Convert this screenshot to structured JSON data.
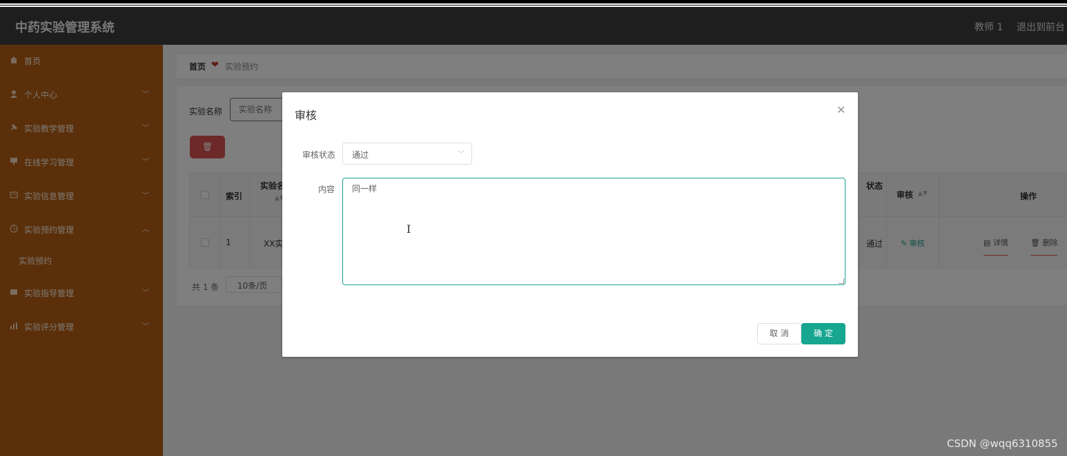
{
  "header": {
    "title": "中药实验管理系统",
    "user": "教师 1",
    "logout": "退出到前台"
  },
  "sidebar": {
    "items": [
      {
        "label": "首页",
        "icon": "home-icon"
      },
      {
        "label": "个人中心",
        "icon": "user-icon",
        "chevron": "﹀"
      },
      {
        "label": "实验教学管理",
        "icon": "pin-icon",
        "chevron": "﹀"
      },
      {
        "label": "在线学习管理",
        "icon": "monitor-icon",
        "chevron": "﹀"
      },
      {
        "label": "实验信息管理",
        "icon": "card-icon",
        "chevron": "﹀"
      },
      {
        "label": "实验预约管理",
        "icon": "clock-icon",
        "chevron": "︿"
      },
      {
        "label": "实验指导管理",
        "icon": "book-icon",
        "chevron": "﹀"
      },
      {
        "label": "实验评分管理",
        "icon": "chart-icon",
        "chevron": "﹀"
      }
    ],
    "sub_item": "实验预约"
  },
  "breadcrumb": {
    "home": "首页",
    "current": "实验预约"
  },
  "search": {
    "label": "实验名称",
    "placeholder": "实验名称"
  },
  "table": {
    "headers": {
      "index": "索引",
      "name": "实验名",
      "status": "状态",
      "audit": "审核",
      "ops": "操作"
    },
    "row": {
      "index": "1",
      "name": "XX实",
      "status": "通过",
      "audit_link": "审核",
      "detail": "详情",
      "delete": "删除"
    }
  },
  "pager": {
    "total": "共 1 条",
    "size": "10条/页"
  },
  "dialog": {
    "title": "审核",
    "status_label": "审核状态",
    "status_value": "通过",
    "content_label": "内容",
    "content_value": "同一样",
    "cancel": "取 消",
    "confirm": "确 定"
  },
  "watermark": "CSDN @wqq6310855",
  "colors": {
    "sidebar": "#b55f15",
    "header": "#3c3c3c",
    "accent": "#17a68f",
    "danger": "#d9534f"
  }
}
